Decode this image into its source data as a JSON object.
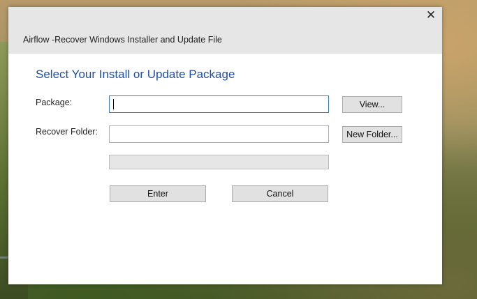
{
  "window": {
    "title": "Airflow -Recover Windows Installer and Update File",
    "close_glyph": "✕"
  },
  "main": {
    "heading": "Select Your Install or Update Package",
    "package": {
      "label": "Package:",
      "value": "",
      "button": "View..."
    },
    "recover_folder": {
      "label": "Recover Folder:",
      "value": "",
      "button": "New Folder..."
    },
    "progress": 0,
    "enter_button": "Enter",
    "cancel_button": "Cancel"
  },
  "colors": {
    "heading": "#1f4fa8",
    "titlebar": "#e6e6e6",
    "focus_border": "#3b76c9"
  }
}
